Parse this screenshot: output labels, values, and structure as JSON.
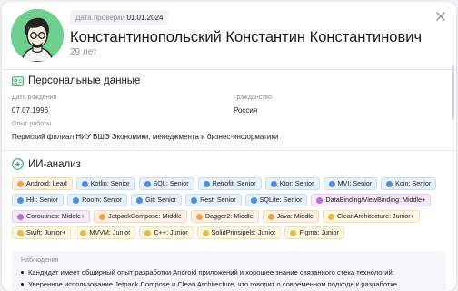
{
  "header": {
    "check_date_label": "Дата проверки",
    "check_date_value": "01.01.2024",
    "name": "Константинопольский Константин Константинович",
    "age": "29 лет"
  },
  "personal": {
    "title": "Персональные данные",
    "birth_date_label": "Дата рождения",
    "birth_date_value": "07.07.1996",
    "citizenship_label": "Гражданство",
    "citizenship_value": "Россия",
    "experience_label": "Опыт работы",
    "experience_value": "Пермский филиал НИУ ВШЭ Экономики, менеджмента и бизнес-информатики"
  },
  "ai": {
    "title": "ИИ-анализ",
    "skills": [
      {
        "label": "Android: Lead",
        "color": "orange"
      },
      {
        "label": "Kotlin: Senior",
        "color": "blue"
      },
      {
        "label": "SQL: Senior",
        "color": "blue"
      },
      {
        "label": "Retrofit: Senior",
        "color": "blue"
      },
      {
        "label": "Ktor: Senior",
        "color": "blue"
      },
      {
        "label": "MVI: Senior",
        "color": "blue"
      },
      {
        "label": "Koin: Senior",
        "color": "blue"
      },
      {
        "label": "Hilt: Senior",
        "color": "blue"
      },
      {
        "label": "Room: Senior",
        "color": "blue"
      },
      {
        "label": "Git: Senior",
        "color": "blue"
      },
      {
        "label": "Rest: Senior",
        "color": "blue"
      },
      {
        "label": "SQLite: Senior",
        "color": "blue"
      },
      {
        "label": "DataBinding/ViewBinding: Middle+",
        "color": "purple"
      },
      {
        "label": "Coroutines: Middle+",
        "color": "purple"
      },
      {
        "label": "JetpackCompose: Middle",
        "color": "orange"
      },
      {
        "label": "Dagger2: Middle",
        "color": "orange"
      },
      {
        "label": "Java: Middle",
        "color": "orange"
      },
      {
        "label": "CleanArchitecture: Junior+",
        "color": "yellow"
      },
      {
        "label": "Swift: Junior+",
        "color": "yellow"
      },
      {
        "label": "MVVM: Junior",
        "color": "yellow"
      },
      {
        "label": "C++: Junior",
        "color": "yellow"
      },
      {
        "label": "SolidPrinsipels: Junior",
        "color": "yellow"
      },
      {
        "label": "Figma: Junior",
        "color": "yellow"
      }
    ],
    "observations_label": "Наблюдения",
    "observations": [
      "Кандидат имеет обширный опыт разработки Android приложений и хорошее знание связанного стека технологий.",
      "Уверенное использование Jetpack Compose и Clean Architecture, что говорит о современном подходе к разработке."
    ]
  },
  "colors": {
    "avatar_bg": "#6ed08f",
    "accent_green": "#2fb36a"
  },
  "icons": {
    "close": "close-icon",
    "personal": "id-card-icon",
    "ai": "ai-sparkle-icon"
  }
}
